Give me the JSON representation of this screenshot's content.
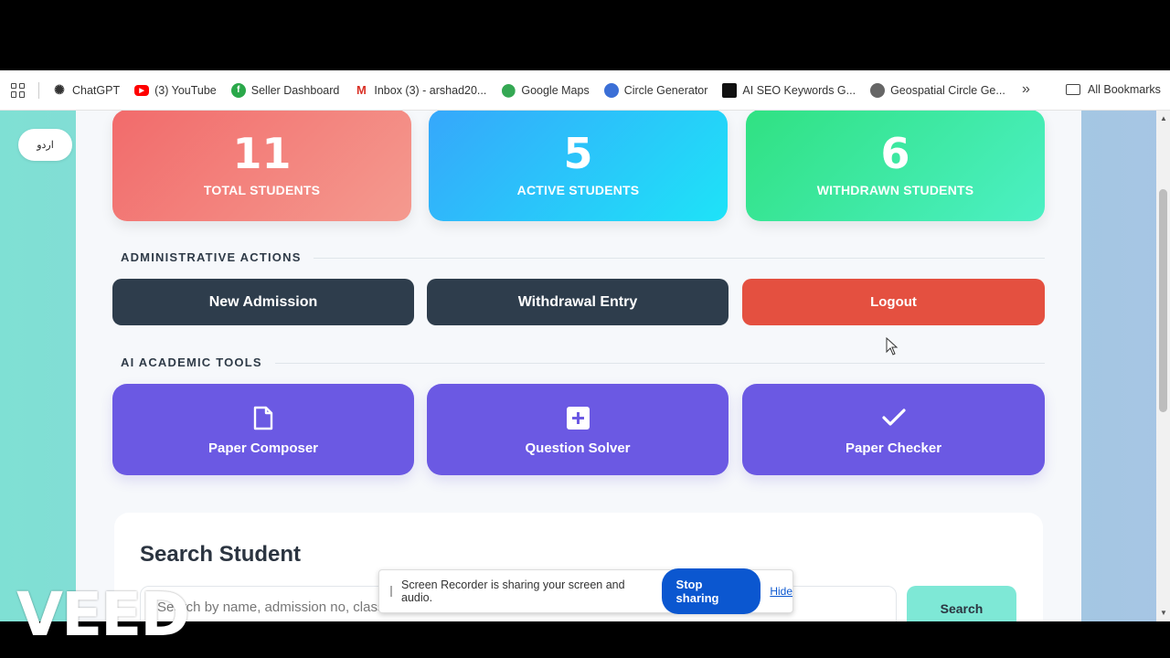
{
  "bookmarks": {
    "items": [
      {
        "label": "ChatGPT",
        "icon": "chatgpt-icon"
      },
      {
        "label": "(3) YouTube",
        "icon": "youtube-icon"
      },
      {
        "label": "Seller Dashboard",
        "icon": "seller-icon"
      },
      {
        "label": "Inbox (3) - arshad20...",
        "icon": "gmail-icon"
      },
      {
        "label": "Google Maps",
        "icon": "maps-icon"
      },
      {
        "label": "Circle Generator",
        "icon": "globe-icon"
      },
      {
        "label": "AI SEO Keywords G...",
        "icon": "seo-icon"
      },
      {
        "label": "Geospatial Circle Ge...",
        "icon": "globe-icon"
      }
    ],
    "more": "»",
    "all_bookmarks": "All Bookmarks"
  },
  "lang_toggle": "اردو",
  "stats": {
    "total": {
      "value": "11",
      "label": "TOTAL STUDENTS"
    },
    "active": {
      "value": "5",
      "label": "ACTIVE STUDENTS"
    },
    "withdrawn": {
      "value": "6",
      "label": "WITHDRAWN STUDENTS"
    }
  },
  "admin": {
    "title": "ADMINISTRATIVE ACTIONS",
    "new_admission": "New Admission",
    "withdrawal_entry": "Withdrawal Entry",
    "logout": "Logout"
  },
  "ai_tools": {
    "title": "AI ACADEMIC TOOLS",
    "paper_composer": "Paper Composer",
    "question_solver": "Question Solver",
    "paper_checker": "Paper Checker"
  },
  "search": {
    "title": "Search Student",
    "placeholder": "Search by name, admission no, class...",
    "button": "Search"
  },
  "share_bar": {
    "message": "Screen Recorder is sharing your screen and audio.",
    "stop": "Stop sharing",
    "hide": "Hide"
  },
  "watermark": "VEED",
  "colors": {
    "total_card": "#f26b6b",
    "active_card": "#36a7fb",
    "withdrawn_card": "#30e182",
    "dark_button": "#2e3d4c",
    "logout_button": "#e45040",
    "tool_card": "#6b59e3",
    "search_button": "#7ee8d6"
  }
}
